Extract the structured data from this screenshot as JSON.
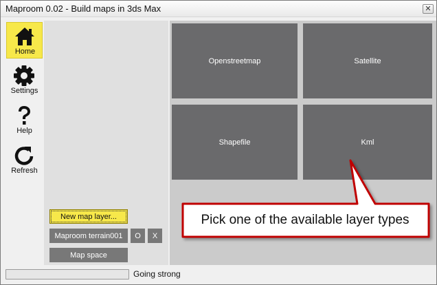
{
  "window": {
    "title": "Maproom 0.02 - Build maps in 3ds Max",
    "close_glyph": "✕"
  },
  "sidebar": {
    "items": [
      {
        "label": "Home",
        "icon": "home-icon",
        "active": true
      },
      {
        "label": "Settings",
        "icon": "gear-icon",
        "active": false
      },
      {
        "label": "Help",
        "icon": "help-icon",
        "active": false
      },
      {
        "label": "Refresh",
        "icon": "refresh-icon",
        "active": false
      }
    ]
  },
  "layer_types": [
    {
      "label": "Openstreetmap"
    },
    {
      "label": "Satellite"
    },
    {
      "label": "Shapefile"
    },
    {
      "label": "Kml"
    }
  ],
  "left_panel": {
    "new_layer_label": "New map layer...",
    "layer_name": "Maproom terrain001",
    "layer_o_label": "O",
    "layer_x_label": "X",
    "map_space_label": "Map space"
  },
  "status": {
    "text": "Going strong",
    "progress": 0.0
  },
  "callout": {
    "text": "Pick one of the available layer types"
  },
  "colors": {
    "accent": "#f7e84a",
    "tile": "#6a6a6c",
    "button": "#787878",
    "callout_border": "#c00000"
  }
}
